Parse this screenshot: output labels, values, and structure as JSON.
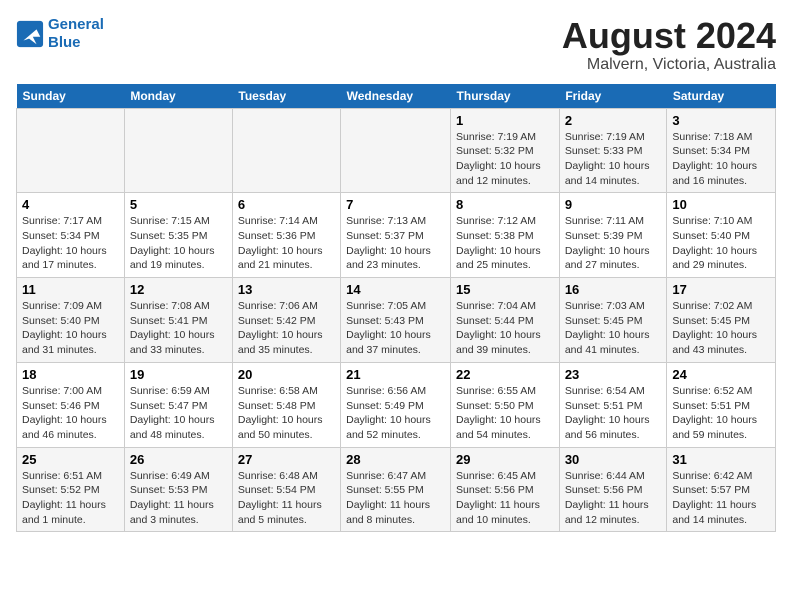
{
  "header": {
    "logo_line1": "General",
    "logo_line2": "Blue",
    "main_title": "August 2024",
    "subtitle": "Malvern, Victoria, Australia"
  },
  "weekdays": [
    "Sunday",
    "Monday",
    "Tuesday",
    "Wednesday",
    "Thursday",
    "Friday",
    "Saturday"
  ],
  "rows": [
    [
      {
        "day": "",
        "info": ""
      },
      {
        "day": "",
        "info": ""
      },
      {
        "day": "",
        "info": ""
      },
      {
        "day": "",
        "info": ""
      },
      {
        "day": "1",
        "info": "Sunrise: 7:19 AM\nSunset: 5:32 PM\nDaylight: 10 hours\nand 12 minutes."
      },
      {
        "day": "2",
        "info": "Sunrise: 7:19 AM\nSunset: 5:33 PM\nDaylight: 10 hours\nand 14 minutes."
      },
      {
        "day": "3",
        "info": "Sunrise: 7:18 AM\nSunset: 5:34 PM\nDaylight: 10 hours\nand 16 minutes."
      }
    ],
    [
      {
        "day": "4",
        "info": "Sunrise: 7:17 AM\nSunset: 5:34 PM\nDaylight: 10 hours\nand 17 minutes."
      },
      {
        "day": "5",
        "info": "Sunrise: 7:15 AM\nSunset: 5:35 PM\nDaylight: 10 hours\nand 19 minutes."
      },
      {
        "day": "6",
        "info": "Sunrise: 7:14 AM\nSunset: 5:36 PM\nDaylight: 10 hours\nand 21 minutes."
      },
      {
        "day": "7",
        "info": "Sunrise: 7:13 AM\nSunset: 5:37 PM\nDaylight: 10 hours\nand 23 minutes."
      },
      {
        "day": "8",
        "info": "Sunrise: 7:12 AM\nSunset: 5:38 PM\nDaylight: 10 hours\nand 25 minutes."
      },
      {
        "day": "9",
        "info": "Sunrise: 7:11 AM\nSunset: 5:39 PM\nDaylight: 10 hours\nand 27 minutes."
      },
      {
        "day": "10",
        "info": "Sunrise: 7:10 AM\nSunset: 5:40 PM\nDaylight: 10 hours\nand 29 minutes."
      }
    ],
    [
      {
        "day": "11",
        "info": "Sunrise: 7:09 AM\nSunset: 5:40 PM\nDaylight: 10 hours\nand 31 minutes."
      },
      {
        "day": "12",
        "info": "Sunrise: 7:08 AM\nSunset: 5:41 PM\nDaylight: 10 hours\nand 33 minutes."
      },
      {
        "day": "13",
        "info": "Sunrise: 7:06 AM\nSunset: 5:42 PM\nDaylight: 10 hours\nand 35 minutes."
      },
      {
        "day": "14",
        "info": "Sunrise: 7:05 AM\nSunset: 5:43 PM\nDaylight: 10 hours\nand 37 minutes."
      },
      {
        "day": "15",
        "info": "Sunrise: 7:04 AM\nSunset: 5:44 PM\nDaylight: 10 hours\nand 39 minutes."
      },
      {
        "day": "16",
        "info": "Sunrise: 7:03 AM\nSunset: 5:45 PM\nDaylight: 10 hours\nand 41 minutes."
      },
      {
        "day": "17",
        "info": "Sunrise: 7:02 AM\nSunset: 5:45 PM\nDaylight: 10 hours\nand 43 minutes."
      }
    ],
    [
      {
        "day": "18",
        "info": "Sunrise: 7:00 AM\nSunset: 5:46 PM\nDaylight: 10 hours\nand 46 minutes."
      },
      {
        "day": "19",
        "info": "Sunrise: 6:59 AM\nSunset: 5:47 PM\nDaylight: 10 hours\nand 48 minutes."
      },
      {
        "day": "20",
        "info": "Sunrise: 6:58 AM\nSunset: 5:48 PM\nDaylight: 10 hours\nand 50 minutes."
      },
      {
        "day": "21",
        "info": "Sunrise: 6:56 AM\nSunset: 5:49 PM\nDaylight: 10 hours\nand 52 minutes."
      },
      {
        "day": "22",
        "info": "Sunrise: 6:55 AM\nSunset: 5:50 PM\nDaylight: 10 hours\nand 54 minutes."
      },
      {
        "day": "23",
        "info": "Sunrise: 6:54 AM\nSunset: 5:51 PM\nDaylight: 10 hours\nand 56 minutes."
      },
      {
        "day": "24",
        "info": "Sunrise: 6:52 AM\nSunset: 5:51 PM\nDaylight: 10 hours\nand 59 minutes."
      }
    ],
    [
      {
        "day": "25",
        "info": "Sunrise: 6:51 AM\nSunset: 5:52 PM\nDaylight: 11 hours\nand 1 minute."
      },
      {
        "day": "26",
        "info": "Sunrise: 6:49 AM\nSunset: 5:53 PM\nDaylight: 11 hours\nand 3 minutes."
      },
      {
        "day": "27",
        "info": "Sunrise: 6:48 AM\nSunset: 5:54 PM\nDaylight: 11 hours\nand 5 minutes."
      },
      {
        "day": "28",
        "info": "Sunrise: 6:47 AM\nSunset: 5:55 PM\nDaylight: 11 hours\nand 8 minutes."
      },
      {
        "day": "29",
        "info": "Sunrise: 6:45 AM\nSunset: 5:56 PM\nDaylight: 11 hours\nand 10 minutes."
      },
      {
        "day": "30",
        "info": "Sunrise: 6:44 AM\nSunset: 5:56 PM\nDaylight: 11 hours\nand 12 minutes."
      },
      {
        "day": "31",
        "info": "Sunrise: 6:42 AM\nSunset: 5:57 PM\nDaylight: 11 hours\nand 14 minutes."
      }
    ]
  ]
}
